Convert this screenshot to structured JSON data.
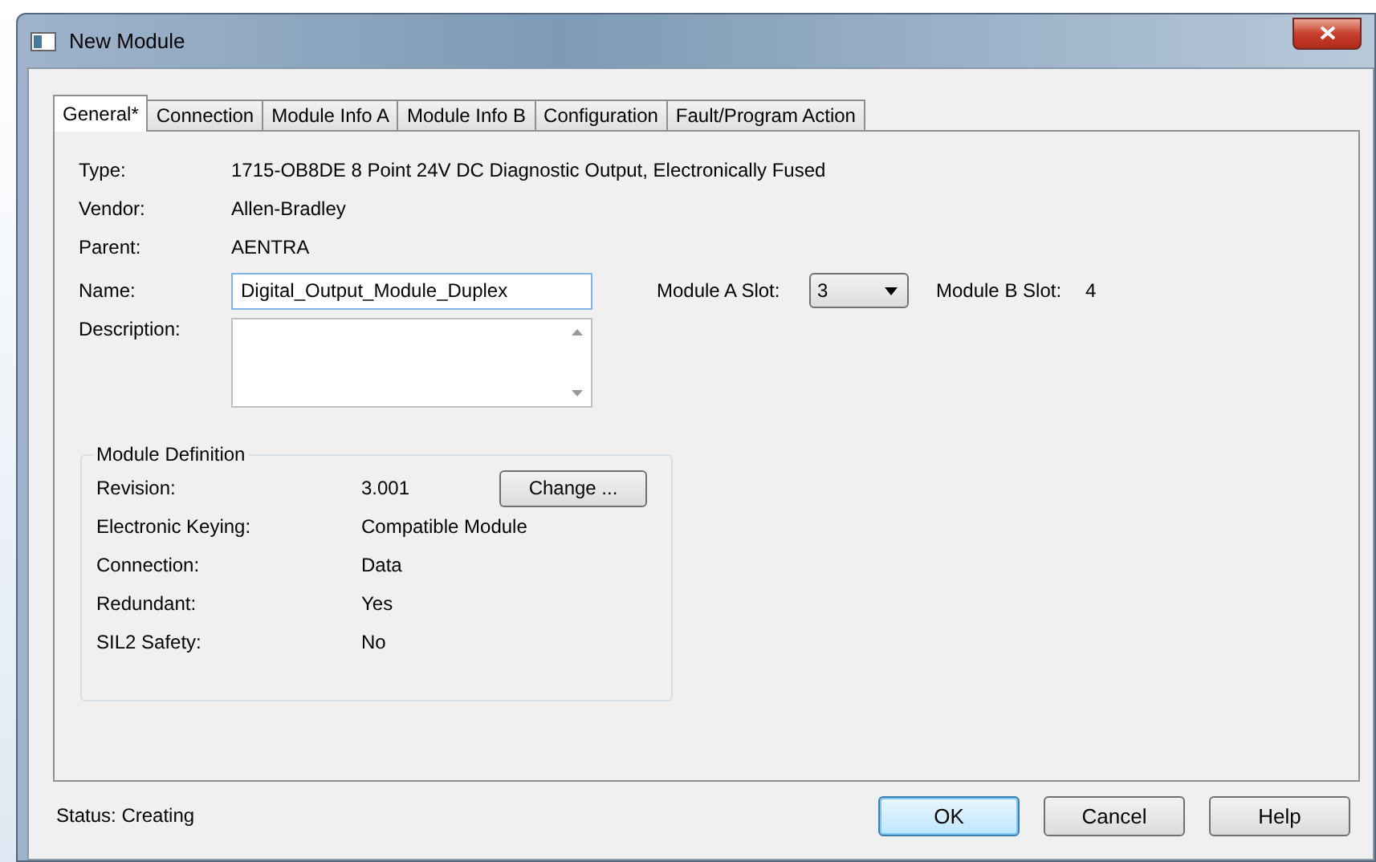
{
  "window": {
    "title": "New Module"
  },
  "tabs": [
    {
      "label": "General*",
      "selected": true
    },
    {
      "label": "Connection",
      "selected": false
    },
    {
      "label": "Module Info A",
      "selected": false
    },
    {
      "label": "Module Info B",
      "selected": false
    },
    {
      "label": "Configuration",
      "selected": false
    },
    {
      "label": "Fault/Program Action",
      "selected": false
    }
  ],
  "info": [
    {
      "label": "Type:",
      "value": "1715-OB8DE 8 Point 24V DC Diagnostic Output, Electronically Fused"
    },
    {
      "label": "Vendor:",
      "value": "Allen-Bradley"
    },
    {
      "label": "Parent:",
      "value": "AENTRA"
    }
  ],
  "name": {
    "label": "Name:",
    "value": "Digital_Output_Module_Duplex"
  },
  "module_a_slot": {
    "label": "Module A Slot:",
    "value": "3"
  },
  "module_b_slot": {
    "label": "Module B Slot:",
    "value": "4"
  },
  "description": {
    "label": "Description:"
  },
  "module_definition": {
    "title": "Module Definition",
    "change_button": "Change ...",
    "rows": [
      {
        "label": "Revision:",
        "value": "3.001"
      },
      {
        "label": "Electronic Keying:",
        "value": "Compatible Module"
      },
      {
        "label": "Connection:",
        "value": "Data"
      },
      {
        "label": "Redundant:",
        "value": "Yes"
      },
      {
        "label": "SIL2 Safety:",
        "value": "No"
      }
    ]
  },
  "status": {
    "label": "Status:",
    "value": "Creating"
  },
  "buttons": [
    {
      "label": "OK",
      "default": true
    },
    {
      "label": "Cancel",
      "default": false
    },
    {
      "label": "Help",
      "default": false
    }
  ]
}
